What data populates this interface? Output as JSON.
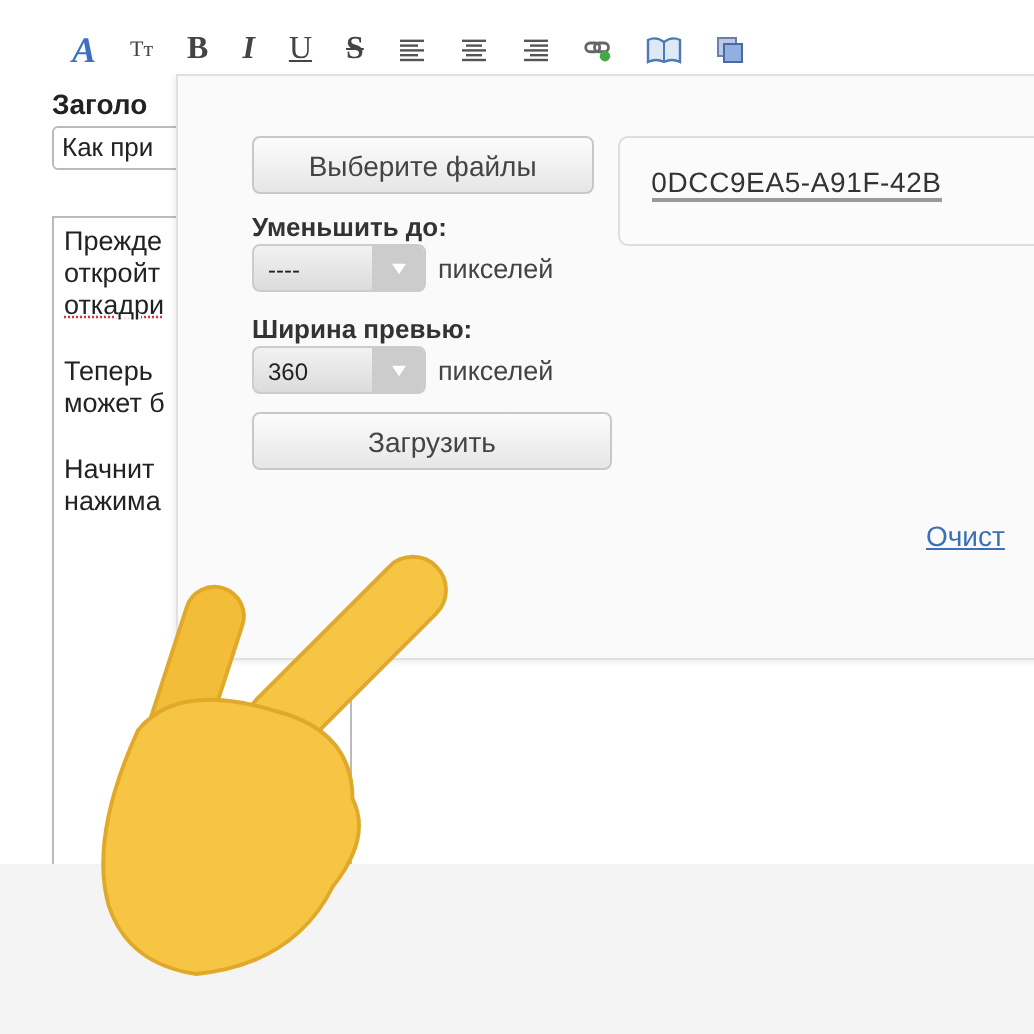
{
  "toolbar": [
    {
      "kind": "color",
      "label": "A"
    },
    {
      "kind": "size",
      "label": "Tт"
    },
    {
      "kind": "bold",
      "label": "B"
    },
    {
      "kind": "italic",
      "label": "I"
    },
    {
      "kind": "underline",
      "label": "U"
    },
    {
      "kind": "strike",
      "label": "S"
    },
    {
      "kind": "align-left"
    },
    {
      "kind": "align-center"
    },
    {
      "kind": "align-right"
    },
    {
      "kind": "link"
    },
    {
      "kind": "book"
    },
    {
      "kind": "gallery"
    }
  ],
  "heading_label": "Заголо",
  "title_field": {
    "value": "Как при"
  },
  "editor": {
    "paragraphs": [
      {
        "lines": [
          {
            "text": "Прежде",
            "misspelled": false
          },
          {
            "text": "откройт",
            "misspelled": false
          },
          {
            "text": "откадри",
            "misspelled": true
          }
        ]
      },
      {
        "lines": [
          {
            "text": "Теперь",
            "misspelled": false
          },
          {
            "text": "может б",
            "misspelled": false
          }
        ]
      },
      {
        "lines": [
          {
            "text": "Начнит",
            "misspelled": false
          },
          {
            "text": "нажима",
            "misspelled": false
          }
        ]
      }
    ]
  },
  "upload_dialog": {
    "choose_button": "Выберите файлы",
    "file_name": "0DCC9EA5-A91F-42B",
    "resize": {
      "label": "Уменьшить до:",
      "value": "----",
      "unit": "пикселей"
    },
    "preview": {
      "label": "Ширина превью:",
      "value": "360",
      "unit": "пикселей"
    },
    "upload_button": "Загрузить",
    "clear_link": "Очист"
  }
}
